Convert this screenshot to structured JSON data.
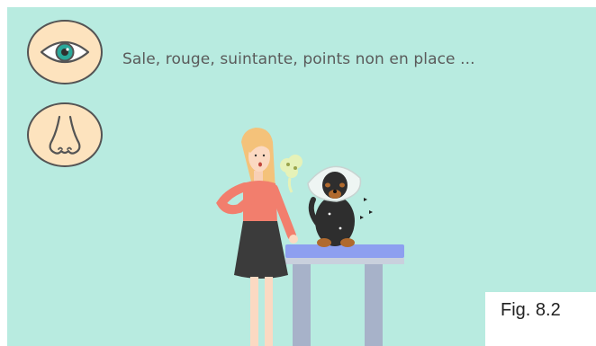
{
  "caption": "Sale, rouge, suintante, points non en place ...",
  "figure_label": "Fig. 8.2",
  "icons": [
    "eye-icon",
    "nose-icon"
  ],
  "colors": {
    "background": "#b8ebe0",
    "icon_fill": "#fde3be",
    "icon_stroke": "#545454",
    "caption_text": "#5a5a5a",
    "table_top": "#8d9ff0",
    "table_legs": "#a7b2c9",
    "shirt": "#f27e6d",
    "skirt": "#3b3b3b",
    "hair": "#f4c27a"
  }
}
